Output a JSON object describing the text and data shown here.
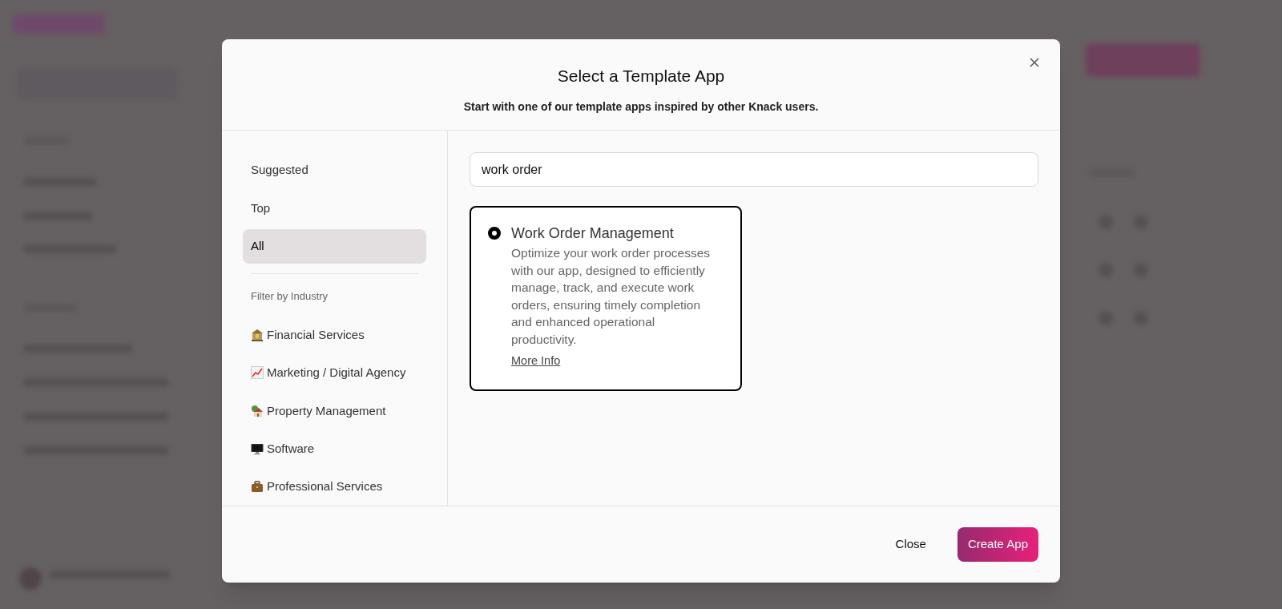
{
  "dialog": {
    "title": "Select a Template App",
    "subtitle": "Start with one of our template apps inspired by other Knack users."
  },
  "categories": [
    {
      "label": "Suggested",
      "selected": false
    },
    {
      "label": "Top",
      "selected": false
    },
    {
      "label": "All",
      "selected": true
    }
  ],
  "filter_heading": "Filter by Industry",
  "industries": [
    {
      "label": "Financial Services",
      "kind": "bank"
    },
    {
      "label": "Marketing / Digital Agency",
      "kind": "chart"
    },
    {
      "label": "Property Management",
      "kind": "house"
    },
    {
      "label": "Software",
      "kind": "monitor"
    },
    {
      "label": "Professional Services",
      "kind": "briefcase"
    }
  ],
  "search": {
    "value": "work order"
  },
  "templates": [
    {
      "title": "Work Order Management",
      "description": "Optimize your work order processes with our app, designed to efficiently manage, track, and execute work orders, ensuring timely completion and enhanced operational productivity.",
      "link": "More Info",
      "selected": true
    }
  ],
  "buttons": {
    "close": "Close",
    "create": "Create App"
  }
}
